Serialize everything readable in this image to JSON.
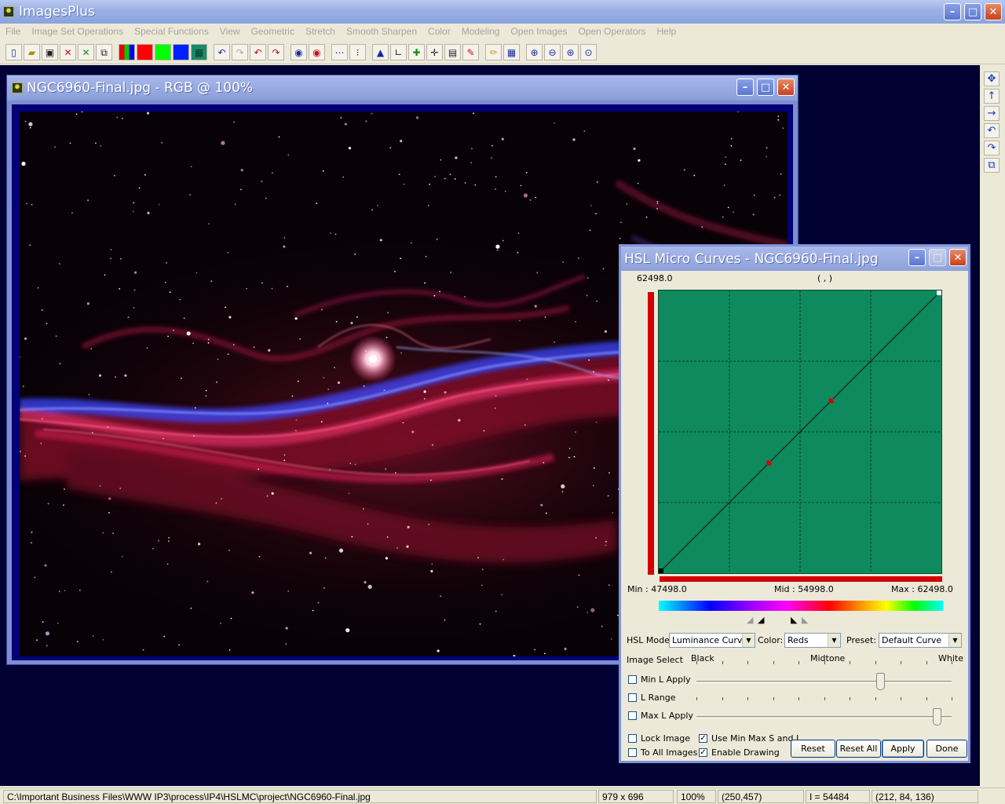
{
  "app": {
    "title": "ImagesPlus"
  },
  "menu": [
    "File",
    "Image Set Operations",
    "Special Functions",
    "View",
    "Geometric",
    "Stretch",
    "Smooth Sharpen",
    "Color",
    "Modeling",
    "Open Images",
    "Open Operators",
    "Help"
  ],
  "toolbar_icons": [
    "new-icon",
    "open-icon",
    "save-icon",
    "close-red-icon",
    "close-green-icon",
    "window-icon",
    "rgb-icon",
    "red-channel-icon",
    "green-channel-icon",
    "blue-channel-icon",
    "grid-icon",
    "undo-icon",
    "redo-icon",
    "undo-red-icon",
    "redo-red-icon",
    "circle-blue-icon",
    "circle-red-icon",
    "dots-icon",
    "points-icon",
    "histogram-icon",
    "axis-icon",
    "plus-icon",
    "crosshair-icon",
    "calculator-icon",
    "paint-icon",
    "pencil-icon",
    "table-icon",
    "zoom-in-icon",
    "zoom-out-icon",
    "zoom-fit-icon",
    "zoom-reset-icon"
  ],
  "right_toolbar_icons": [
    "move-icon",
    "arrow-up-icon",
    "arrow-right-icon",
    "rotate-left-icon",
    "rotate-right-icon",
    "copy-icon"
  ],
  "image_window": {
    "title": "NGC6960-Final.jpg - RGB @ 100%"
  },
  "dialog": {
    "title": "HSL Micro Curves - NGC6960-Final.jpg",
    "top_value": "62498.0",
    "coords": "( , )",
    "min_label": "Min : 47498.0",
    "mid_label": "Mid : 54998.0",
    "max_label": "Max : 62498.0",
    "hsl_mode_label": "HSL Mode:",
    "hsl_mode_value": "Luminance Curve",
    "color_label": "Color:",
    "color_value": "Reds",
    "preset_label": "Preset:",
    "preset_value": "Default Curve",
    "image_select_label": "Image Select",
    "black_label": "Black",
    "midtone_label": "Midtone",
    "white_label": "White",
    "min_l_apply": "Min L Apply",
    "l_range": "L Range",
    "max_l_apply": "Max L Apply",
    "lock_image": "Lock Image",
    "to_all_images": "To All Images",
    "use_min_max": "Use Min Max S and L",
    "enable_drawing": "Enable Drawing",
    "min_l_slider": 0.72,
    "max_l_slider": 0.94,
    "checkboxes": {
      "min_l_apply": false,
      "l_range": false,
      "max_l_apply": false,
      "lock_image": false,
      "to_all_images": false,
      "use_min_max": true,
      "enable_drawing": true
    },
    "buttons": {
      "reset": "Reset",
      "reset_all": "Reset All",
      "apply": "Apply",
      "done": "Done"
    },
    "curve_points": [
      [
        0,
        0
      ],
      [
        0.39,
        0.39
      ],
      [
        0.61,
        0.61
      ],
      [
        1,
        1
      ]
    ],
    "colors": {
      "curve_bg": "#0e8a5e",
      "point": "#d40000"
    }
  },
  "status": {
    "path": "C:\\Important Business Files\\WWW IP3\\process\\IP4\\HSLMC\\project\\NGC6960-Final.jpg",
    "size": "979 x 696",
    "zoom": "100%",
    "position": "(250,457)",
    "intensity": "I = 54484",
    "rgb": "(212, 84, 136)"
  }
}
